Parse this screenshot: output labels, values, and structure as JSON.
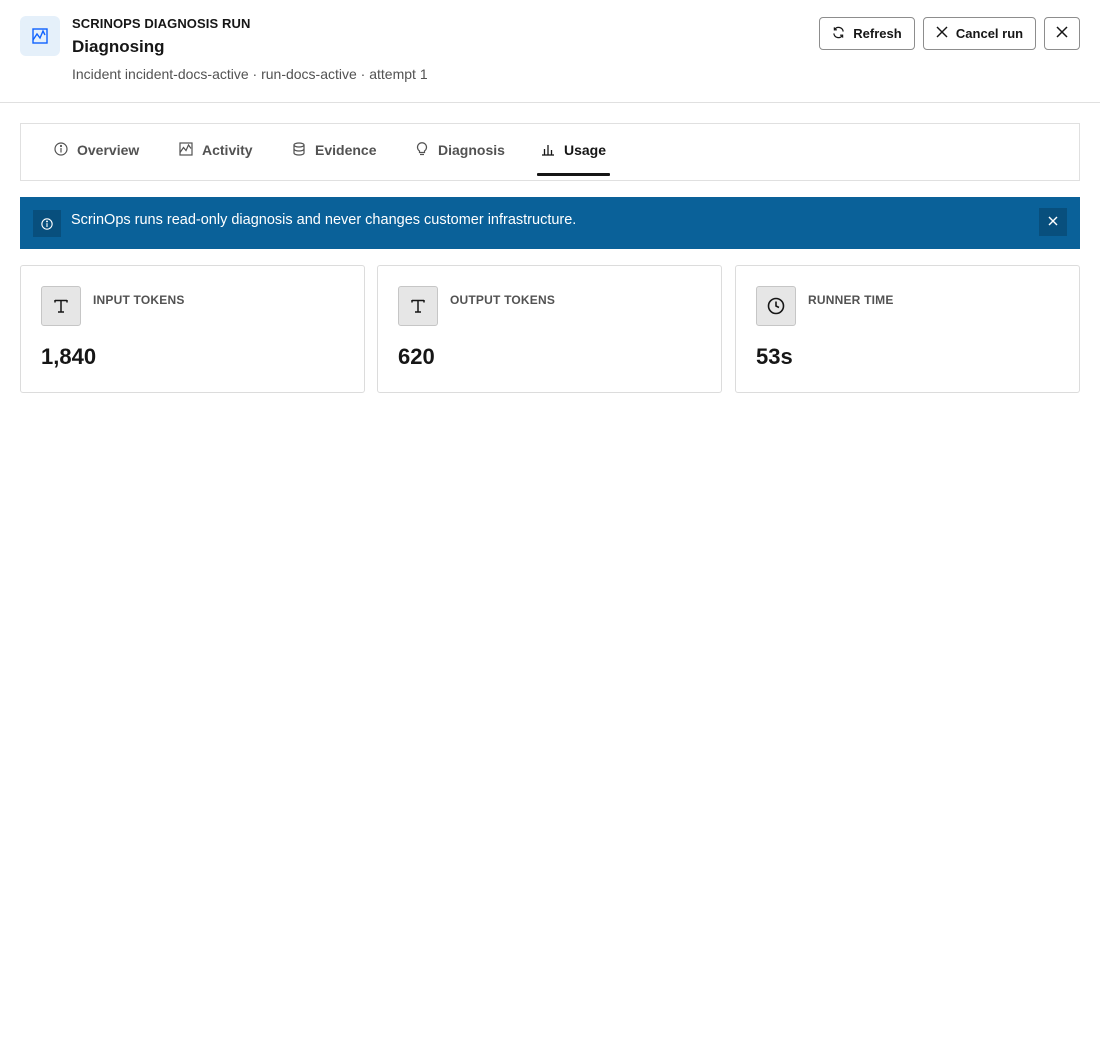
{
  "header": {
    "eyebrow": "SCRINOPS DIAGNOSIS RUN",
    "title": "Diagnosing",
    "subtitle": "Incident incident-docs-active · run-docs-active · attempt 1",
    "app_icon": "activity-chart-icon",
    "refresh_label": "Refresh",
    "refresh_icon": "refresh-icon",
    "cancel_label": "Cancel run",
    "cancel_icon": "close-icon",
    "close_icon": "close-icon"
  },
  "tabs": [
    {
      "label": "Overview",
      "icon": "info-icon"
    },
    {
      "label": "Activity",
      "icon": "activity-chart-icon"
    },
    {
      "label": "Evidence",
      "icon": "database-icon"
    },
    {
      "label": "Diagnosis",
      "icon": "lightbulb-icon"
    },
    {
      "label": "Usage",
      "icon": "bar-chart-icon",
      "active": true
    }
  ],
  "banner": {
    "text": "ScrinOps runs read-only diagnosis and never changes customer infrastructure.",
    "icon": "info-icon",
    "close_icon": "close-icon",
    "background": "#0a6199"
  },
  "metrics": [
    {
      "label": "INPUT TOKENS",
      "value": "1,840",
      "icon": "text-icon"
    },
    {
      "label": "OUTPUT TOKENS",
      "value": "620",
      "icon": "text-icon"
    },
    {
      "label": "RUNNER TIME",
      "value": "53s",
      "icon": "clock-icon"
    }
  ],
  "colors": {
    "accent": "#0a6199",
    "app_icon_bg": "#e5f0fa",
    "text_primary": "#161616",
    "text_secondary": "#525252"
  }
}
